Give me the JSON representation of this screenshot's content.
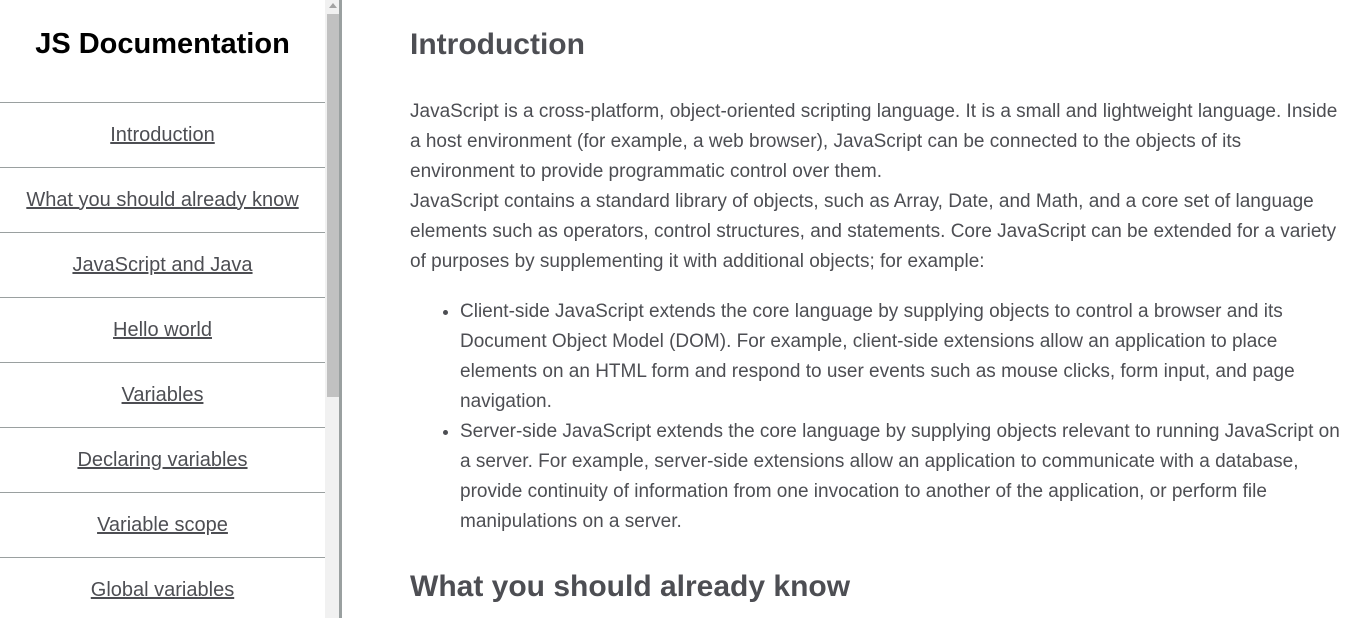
{
  "sidebar": {
    "title": "JS Documentation",
    "items": [
      {
        "label": "Introduction"
      },
      {
        "label": "What you should already know"
      },
      {
        "label": "JavaScript and Java"
      },
      {
        "label": "Hello world"
      },
      {
        "label": "Variables"
      },
      {
        "label": "Declaring variables"
      },
      {
        "label": "Variable scope"
      },
      {
        "label": "Global variables"
      }
    ]
  },
  "main": {
    "intro": {
      "title": "Introduction",
      "p1": "JavaScript is a cross-platform, object-oriented scripting language. It is a small and lightweight language. Inside a host environment (for example, a web browser), JavaScript can be connected to the objects of its environment to provide programmatic control over them.",
      "p2": "JavaScript contains a standard library of objects, such as Array, Date, and Math, and a core set of language elements such as operators, control structures, and statements. Core JavaScript can be extended for a variety of purposes by supplementing it with additional objects; for example:",
      "bullets": [
        "Client-side JavaScript extends the core language by supplying objects to control a browser and its Document Object Model (DOM). For example, client-side extensions allow an application to place elements on an HTML form and respond to user events such as mouse clicks, form input, and page navigation.",
        "Server-side JavaScript extends the core language by supplying objects relevant to running JavaScript on a server. For example, server-side extensions allow an application to communicate with a database, provide continuity of information from one invocation to another of the application, or perform file manipulations on a server."
      ]
    },
    "know": {
      "title": "What you should already know"
    }
  },
  "colors": {
    "text": "#4d4e53",
    "title": "#000000",
    "border": "#9aa0a0"
  }
}
